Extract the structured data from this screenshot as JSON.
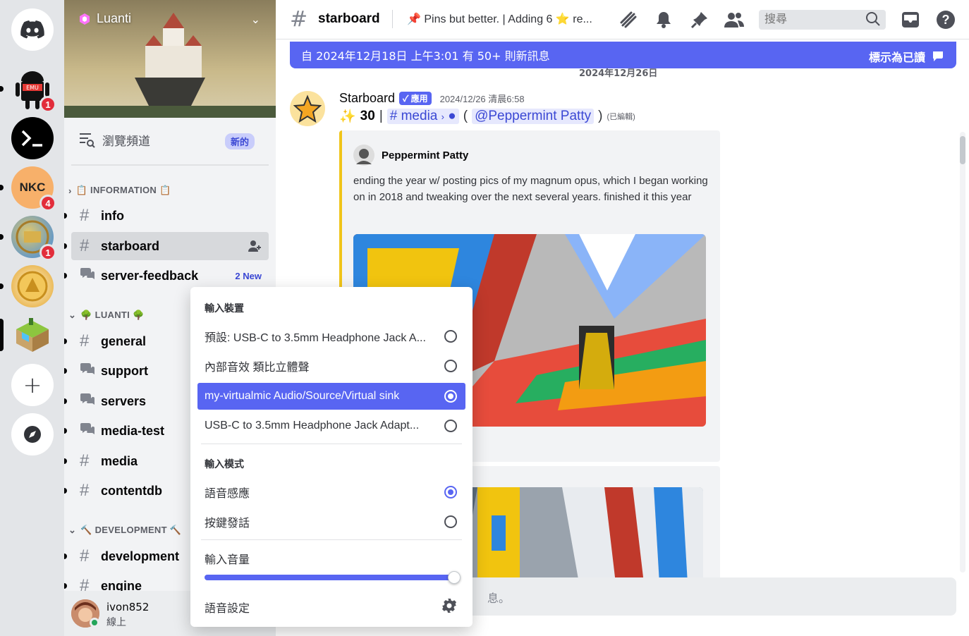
{
  "rail": {
    "servers": [
      {
        "name": "Discord home"
      },
      {
        "name": "Emu server",
        "badge": "1",
        "icon_label": "EMU"
      },
      {
        "name": "Terminal server"
      },
      {
        "name": "NKC server",
        "badge": "4",
        "icon_label": "NKC"
      },
      {
        "name": "Map server",
        "badge": "1"
      },
      {
        "name": "Emblem server"
      },
      {
        "name": "Luanti server"
      }
    ],
    "add_label": "+"
  },
  "sidebar": {
    "server_name": "Luanti",
    "browse_label": "瀏覽頻道",
    "browse_badge": "新的",
    "categories": [
      {
        "name": "📋 INFORMATION 📋"
      },
      {
        "name": "🌳 LUANTI 🌳"
      },
      {
        "name": "🔨 DEVELOPMENT 🔨"
      }
    ],
    "channels": [
      {
        "name": "info",
        "type": "text"
      },
      {
        "name": "starboard",
        "type": "text"
      },
      {
        "name": "server-feedback",
        "type": "forum",
        "tail": "2 New"
      },
      {
        "name": "general",
        "type": "text"
      },
      {
        "name": "support",
        "type": "forum"
      },
      {
        "name": "servers",
        "type": "forum"
      },
      {
        "name": "media-test",
        "type": "forum"
      },
      {
        "name": "media",
        "type": "text"
      },
      {
        "name": "contentdb",
        "type": "text"
      },
      {
        "name": "development",
        "type": "text"
      },
      {
        "name": "engine",
        "type": "text"
      }
    ],
    "user": {
      "name": "ivon852",
      "status": "線上",
      "status_color": "#23a55a"
    }
  },
  "header": {
    "channel_name": "starboard",
    "topic": "📌 Pins but better. | Adding 6 ⭐ re...",
    "search_placeholder": "搜尋"
  },
  "chat": {
    "new_messages_bar": "自 2024年12月18日 上午3:01 有 50+ 則新訊息",
    "mark_read": "標示為已讀",
    "date_separator": "2024年12月26日",
    "message": {
      "author": "Starboard",
      "app_tag": "✓ 應用",
      "timestamp": "2024/12/26 清晨6:58",
      "star_count": "30",
      "channel_mention": "media",
      "user_mention": "@Peppermint Patty",
      "edited": "(已編輯)",
      "embed_author": "Peppermint Patty",
      "embed_text": "ending the year w/ posting pics of my magnum opus, which I began working on in 2018 and tweaking over the next several years. finished it this year"
    },
    "composer_placeholder": "息。"
  },
  "popup": {
    "input_device_title": "輸入裝置",
    "devices": [
      {
        "label": "預設: USB-C to 3.5mm Headphone Jack A...",
        "selected": false
      },
      {
        "label": "內部音效 類比立體聲",
        "selected": false
      },
      {
        "label": "my-virtualmic Audio/Source/Virtual sink",
        "selected": true
      },
      {
        "label": "USB-C to 3.5mm Headphone Jack Adapt...",
        "selected": false
      }
    ],
    "input_mode_title": "輸入模式",
    "modes": [
      {
        "label": "語音感應",
        "selected": true
      },
      {
        "label": "按鍵發話",
        "selected": false
      }
    ],
    "volume_label": "輸入音量",
    "volume_percent": 100,
    "voice_settings_label": "語音設定"
  },
  "colors": {
    "accent": "#5865f2",
    "star": "#f0c419",
    "badge": "#e22d3b"
  }
}
